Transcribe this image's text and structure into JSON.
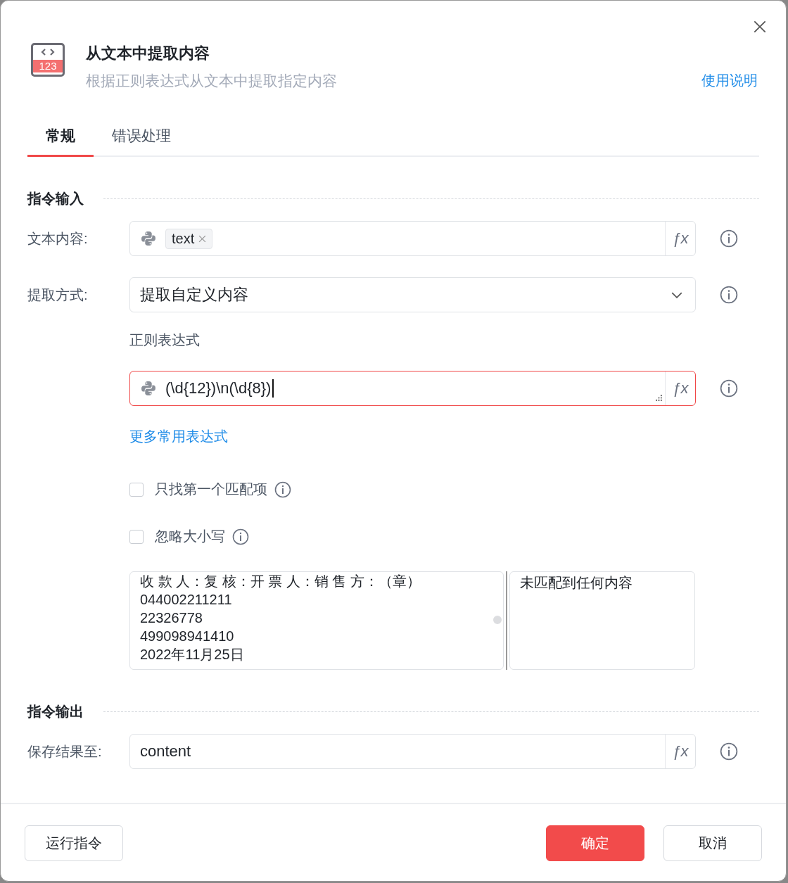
{
  "dialog": {
    "icon_text": "123",
    "title": "从文本中提取内容",
    "subtitle": "根据正则表达式从文本中提取指定内容",
    "help_link": "使用说明"
  },
  "tabs": [
    {
      "label": "常规",
      "selected": true
    },
    {
      "label": "错误处理",
      "selected": false
    }
  ],
  "input_section": {
    "heading": "指令输入"
  },
  "text_content": {
    "label": "文本内容:",
    "variable_tag": "text",
    "fx": "ƒx"
  },
  "extract_mode": {
    "label": "提取方式:",
    "value": "提取自定义内容"
  },
  "regex": {
    "label": "正则表达式",
    "value": "(\\d{12})\\n(\\d{8})",
    "focused": true,
    "fx": "ƒx"
  },
  "more_link": "更多常用表达式",
  "options": [
    {
      "label": "只找第一个匹配项",
      "checked": false
    },
    {
      "label": "忽略大小写",
      "checked": false
    }
  ],
  "preview": {
    "sample_lines": [
      "收 款 人：复 核：开 票 人：销 售 方：（章）",
      "044002211211",
      "22326778",
      "499098941410",
      "2022年11月25日"
    ],
    "result": "未匹配到任何内容"
  },
  "output_section": {
    "heading": "指令输出"
  },
  "save_result": {
    "label": "保存结果至:",
    "value": "content",
    "fx": "ƒx"
  },
  "footer": {
    "run_button": "运行指令",
    "confirm_button": "确定",
    "cancel_button": "取消"
  }
}
